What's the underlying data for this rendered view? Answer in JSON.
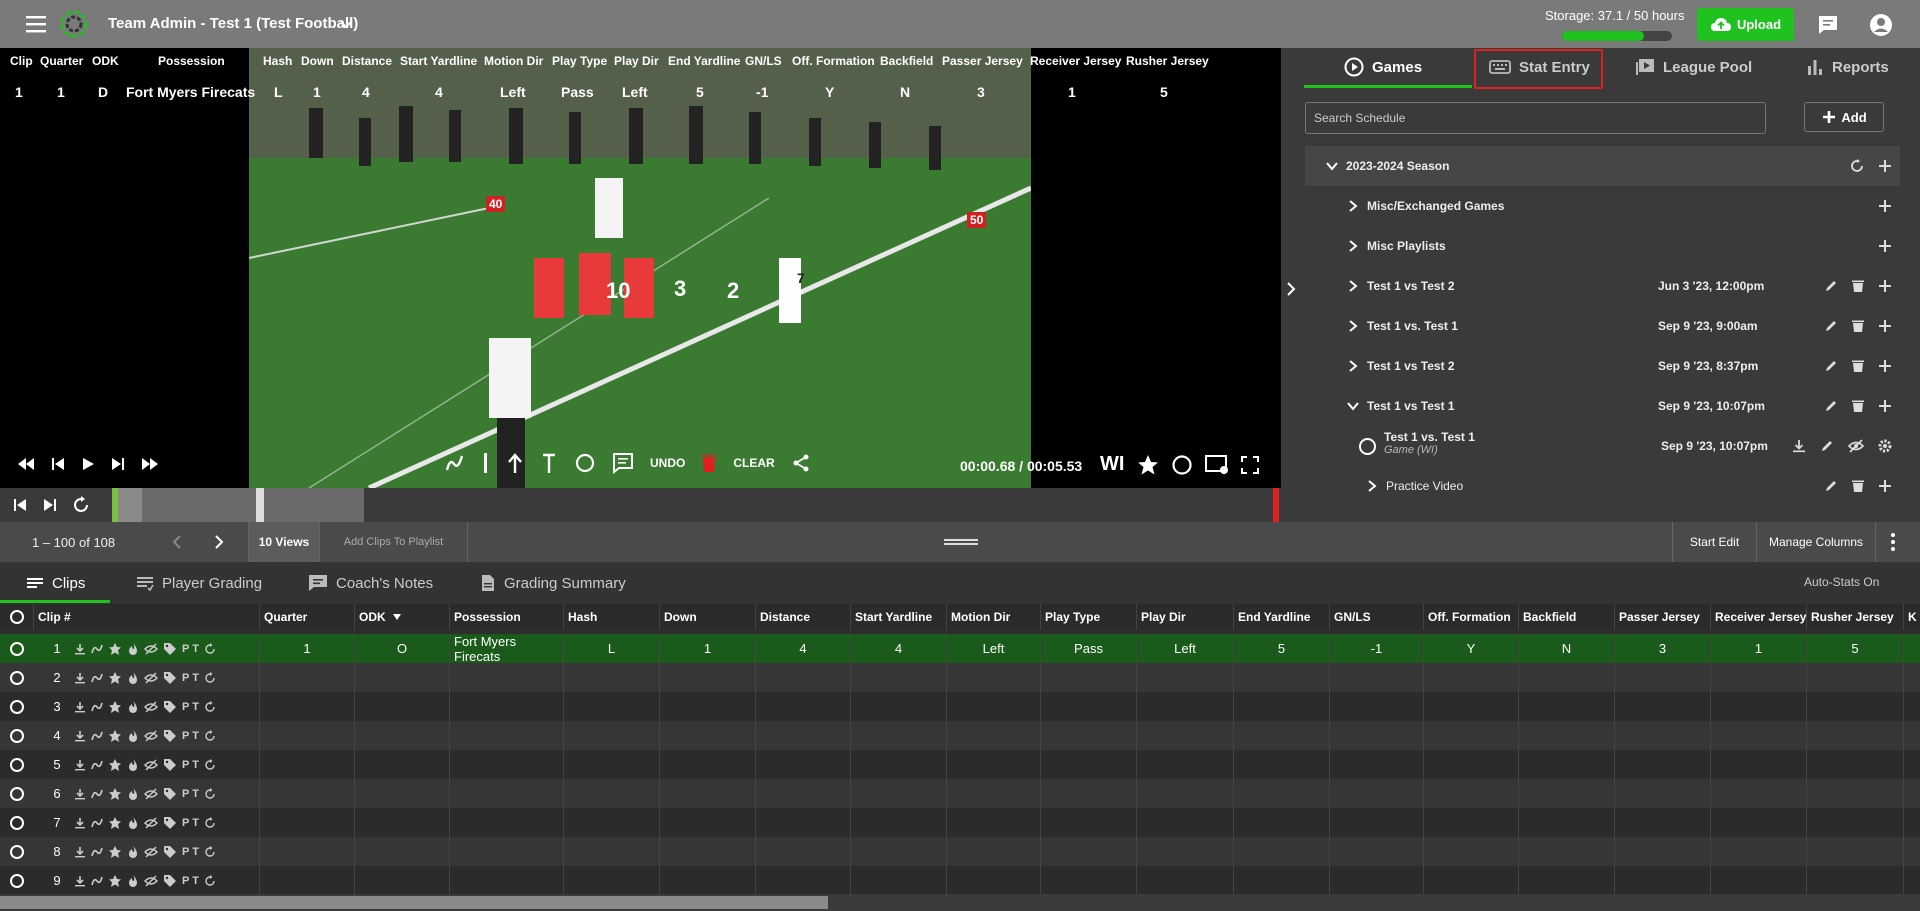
{
  "header": {
    "title": "Team Admin - Test 1 (Test Football)",
    "storage_label": "Storage: 37.1 / 50 hours",
    "storage_used": 37.1,
    "storage_total": 50,
    "upload_label": "Upload"
  },
  "video_overlay": {
    "columns": [
      {
        "head": "Clip",
        "value": "1"
      },
      {
        "head": "Quarter",
        "value": "1"
      },
      {
        "head": "ODK",
        "value": "D"
      },
      {
        "head": "Possession",
        "value": "Fort Myers Firecats"
      },
      {
        "head": "Hash",
        "value": "L"
      },
      {
        "head": "Down",
        "value": "1"
      },
      {
        "head": "Distance",
        "value": "4"
      },
      {
        "head": "Start Yardline",
        "value": "4"
      },
      {
        "head": "Motion Dir",
        "value": "Left"
      },
      {
        "head": "Play Type",
        "value": "Pass"
      },
      {
        "head": "Play Dir",
        "value": "Left"
      },
      {
        "head": "End Yardline",
        "value": "5"
      },
      {
        "head": "GN/LS",
        "value": "-1"
      },
      {
        "head": "Off. Formation",
        "value": "Y"
      },
      {
        "head": "Backfield",
        "value": "N"
      },
      {
        "head": "Passer Jersey",
        "value": "3"
      },
      {
        "head": "Receiver Jersey",
        "value": "1"
      },
      {
        "head": "Rusher Jersey",
        "value": "5"
      }
    ],
    "field_markers": [
      "40",
      "50"
    ],
    "jerseys": [
      "10",
      "3",
      "2",
      "7"
    ]
  },
  "video_controls": {
    "undo_label": "UNDO",
    "clear_label": "CLEAR",
    "timecode": "00:00.68 / 00:05.53",
    "wi_label": "WI",
    "progress": 0.12
  },
  "right_panel": {
    "tabs": [
      {
        "label": "Games",
        "active": true
      },
      {
        "label": "Stat Entry",
        "active": false
      },
      {
        "label": "League Pool",
        "active": false
      },
      {
        "label": "Reports",
        "active": false
      }
    ],
    "search_placeholder": "Search Schedule",
    "add_label": "Add",
    "tree": [
      {
        "type": "season",
        "label": "2023-2024 Season",
        "date": ""
      },
      {
        "type": "folder",
        "label": "Misc/Exchanged Games",
        "date": ""
      },
      {
        "type": "folder",
        "label": "Misc Playlists",
        "date": ""
      },
      {
        "type": "game",
        "label": "Test 1 vs Test 2",
        "date": "Jun 3 '23, 12:00pm"
      },
      {
        "type": "game",
        "label": "Test 1 vs. Test 1",
        "date": "Sep 9 '23, 9:00am"
      },
      {
        "type": "game",
        "label": "Test 1 vs Test 2",
        "date": "Sep 9 '23, 8:37pm"
      },
      {
        "type": "game-open",
        "label": "Test 1 vs Test 1",
        "date": "Sep 9 '23, 10:07pm"
      },
      {
        "type": "video",
        "label": "Test 1 vs. Test 1",
        "sub": "Game (WI)",
        "date": "Sep 9 '23, 10:07pm"
      },
      {
        "type": "practice",
        "label": "Practice Video",
        "date": ""
      }
    ]
  },
  "pagination": {
    "range": "1 – 100 of 108",
    "views_label": "10 Views",
    "add_playlist_label": "Add Clips To Playlist",
    "start_edit_label": "Start Edit",
    "manage_columns_label": "Manage Columns"
  },
  "subtabs": [
    {
      "label": "Clips",
      "active": true
    },
    {
      "label": "Player Grading",
      "active": false
    },
    {
      "label": "Coach's Notes",
      "active": false
    },
    {
      "label": "Grading Summary",
      "active": false
    }
  ],
  "auto_stats_label": "Auto-Stats On",
  "table": {
    "headers": [
      "Clip #",
      "Quarter",
      "ODK",
      "Possession",
      "Hash",
      "Down",
      "Distance",
      "Start Yardline",
      "Motion Dir",
      "Play Type",
      "Play Dir",
      "End Yardline",
      "GN/LS",
      "Off. Formation",
      "Backfield",
      "Passer Jersey",
      "Receiver Jersey",
      "Rusher Jersey",
      "K"
    ],
    "row_icon_letters": "P T",
    "rows": [
      {
        "clip": "1",
        "cells": [
          "1",
          "O",
          "Fort Myers Firecats",
          "L",
          "1",
          "4",
          "4",
          "Left",
          "Pass",
          "Left",
          "5",
          "-1",
          "Y",
          "N",
          "3",
          "1",
          "5"
        ]
      },
      {
        "clip": "2",
        "cells": []
      },
      {
        "clip": "3",
        "cells": []
      },
      {
        "clip": "4",
        "cells": []
      },
      {
        "clip": "5",
        "cells": []
      },
      {
        "clip": "6",
        "cells": []
      },
      {
        "clip": "7",
        "cells": []
      },
      {
        "clip": "8",
        "cells": []
      },
      {
        "clip": "9",
        "cells": []
      }
    ]
  }
}
